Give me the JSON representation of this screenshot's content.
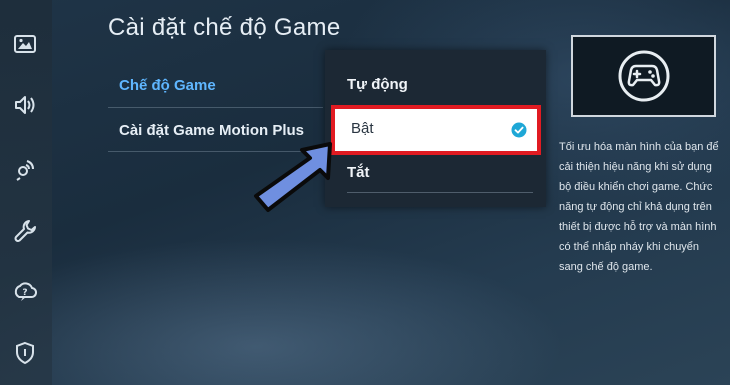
{
  "page": {
    "title": "Cài đặt chế độ Game"
  },
  "sidebar": {
    "items": [
      {
        "icon": "picture-icon"
      },
      {
        "icon": "sound-icon"
      },
      {
        "icon": "connection-icon"
      },
      {
        "icon": "wrench-icon"
      },
      {
        "icon": "support-icon"
      },
      {
        "icon": "shield-icon"
      }
    ]
  },
  "menu": {
    "items": [
      {
        "label": "Chế độ Game",
        "active": true
      },
      {
        "label": "Cài đặt Game Motion Plus",
        "active": false
      }
    ]
  },
  "dropdown": {
    "options": [
      {
        "label": "Tự động"
      },
      {
        "label": "Bật",
        "selected": true
      },
      {
        "label": "Tắt"
      }
    ]
  },
  "preview": {
    "icon": "gamepad-icon"
  },
  "description": "Tối ưu hóa màn hình của bạn để cải thiện hiệu năng khi sử dụng bộ điều khiển chơi game. Chức năng tự động chỉ khả dụng trên thiết bị được hỗ trợ và màn hình có thể nhấp nháy khi chuyển sang chế độ game.",
  "colors": {
    "accent_blue": "#5fb6ff",
    "highlight_border": "#e11b22",
    "check_color": "#1ea7d6",
    "arrow_fill": "#6f8fe0"
  }
}
